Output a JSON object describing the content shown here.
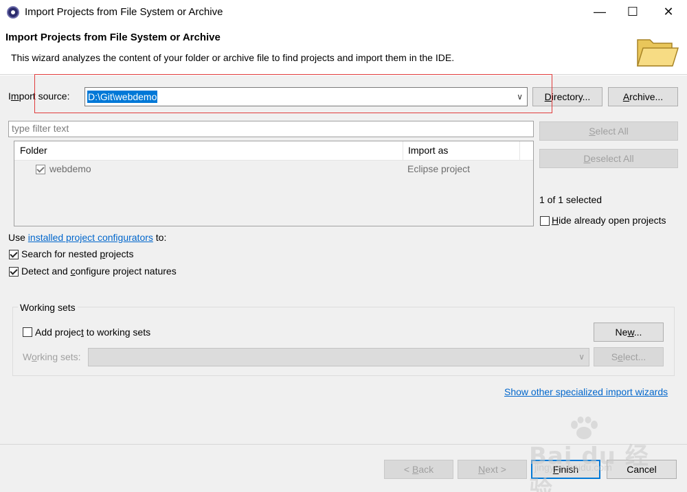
{
  "window": {
    "title": "Import Projects from File System or Archive"
  },
  "header": {
    "title": "Import Projects from File System or Archive",
    "description": "This wizard analyzes the content of your folder or archive file to find projects and import them in the IDE."
  },
  "import_source": {
    "label_pre": "I",
    "label_u": "m",
    "label_post": "port source:",
    "value": "D:\\Git\\webdemo",
    "directory_button": {
      "pre": "",
      "u": "D",
      "post": "irectory..."
    },
    "archive_button": {
      "pre": "",
      "u": "A",
      "post": "rchive..."
    }
  },
  "filter": {
    "placeholder": "type filter text"
  },
  "table": {
    "columns": [
      "Folder",
      "Import as"
    ],
    "rows": [
      {
        "folder": "webdemo",
        "import_as": "Eclipse project",
        "checked": true
      }
    ]
  },
  "side": {
    "select_all": {
      "pre": "",
      "u": "S",
      "post": "elect All"
    },
    "deselect_all": {
      "pre": "",
      "u": "D",
      "post": "eselect All"
    },
    "selected_count": "1 of 1 selected",
    "hide_open": {
      "pre": "",
      "u": "H",
      "post": "ide already open projects",
      "checked": false
    }
  },
  "configurators": {
    "pre": "Use ",
    "link": "installed project configurators",
    "post": " to:"
  },
  "options": {
    "nested": {
      "pre": "Search for nested ",
      "u": "p",
      "post": "rojects",
      "checked": true
    },
    "detect": {
      "pre": "Detect and ",
      "u": "c",
      "post": "onfigure project natures",
      "checked": true
    }
  },
  "working_sets": {
    "title": "Working sets",
    "add": {
      "pre": "Add projec",
      "u": "t",
      "post": " to working sets",
      "checked": false
    },
    "new_button": {
      "pre": "Ne",
      "u": "w",
      "post": "..."
    },
    "label": {
      "pre": "W",
      "u": "o",
      "post": "rking sets:"
    },
    "select_button": {
      "pre": "S",
      "u": "e",
      "post": "lect..."
    }
  },
  "other_wizards_link": "Show other specialized import wizards",
  "footer": {
    "back": {
      "pre": "< ",
      "u": "B",
      "post": "ack"
    },
    "next": {
      "pre": "",
      "u": "N",
      "post": "ext >"
    },
    "finish": {
      "pre": "",
      "u": "F",
      "post": "inish"
    },
    "cancel": "Cancel"
  },
  "watermark": {
    "text": "Bai du 经验",
    "sub": "jingyan.baidu.com"
  },
  "colors": {
    "accent": "#0078d7",
    "link": "#0066cc",
    "highlight_box": "#e03a3a"
  }
}
